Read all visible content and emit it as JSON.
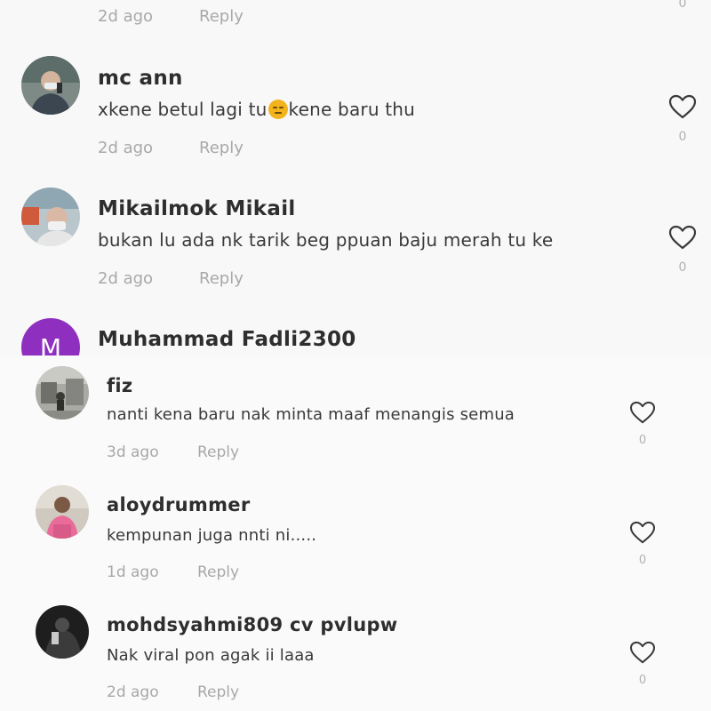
{
  "top_panel": {
    "partial_row": {
      "time": "2d ago",
      "reply": "Reply",
      "likes": "0"
    },
    "comments": [
      {
        "username": "mc ann",
        "text_before": "xkene betul lagi tu",
        "emoji": "pensive-face-emoji",
        "text_after": "kene baru thu",
        "time": "2d ago",
        "reply": "Reply",
        "likes": "0"
      },
      {
        "username": "Mikailmok Mikail",
        "text": "bukan lu ada nk tarik beg ppuan baju merah tu ke",
        "time": "2d ago",
        "reply": "Reply",
        "likes": "0"
      },
      {
        "username": "Muhammad Fadli2300",
        "avatar_letter": "M",
        "avatar_color": "#8f2fbf"
      }
    ]
  },
  "bottom_panel": {
    "comments": [
      {
        "username": "fiz",
        "text": "nanti kena baru nak minta maaf menangis semua",
        "time": "3d ago",
        "reply": "Reply",
        "likes": "0"
      },
      {
        "username": "aloydrummer",
        "text": "kempunan juga nnti ni.....",
        "time": "1d ago",
        "reply": "Reply",
        "likes": "0"
      },
      {
        "username": "mohdsyahmi809 cv pvlupw",
        "text": "Nak viral pon agak ii laaa",
        "time": "2d ago",
        "reply": "Reply",
        "likes": "0"
      }
    ]
  },
  "icons": {
    "like": "heart-outline-icon"
  },
  "colors": {
    "background": "#f8f8f8",
    "meta_text": "#a8a8a8",
    "letter_avatar": "#8f2fbf"
  }
}
